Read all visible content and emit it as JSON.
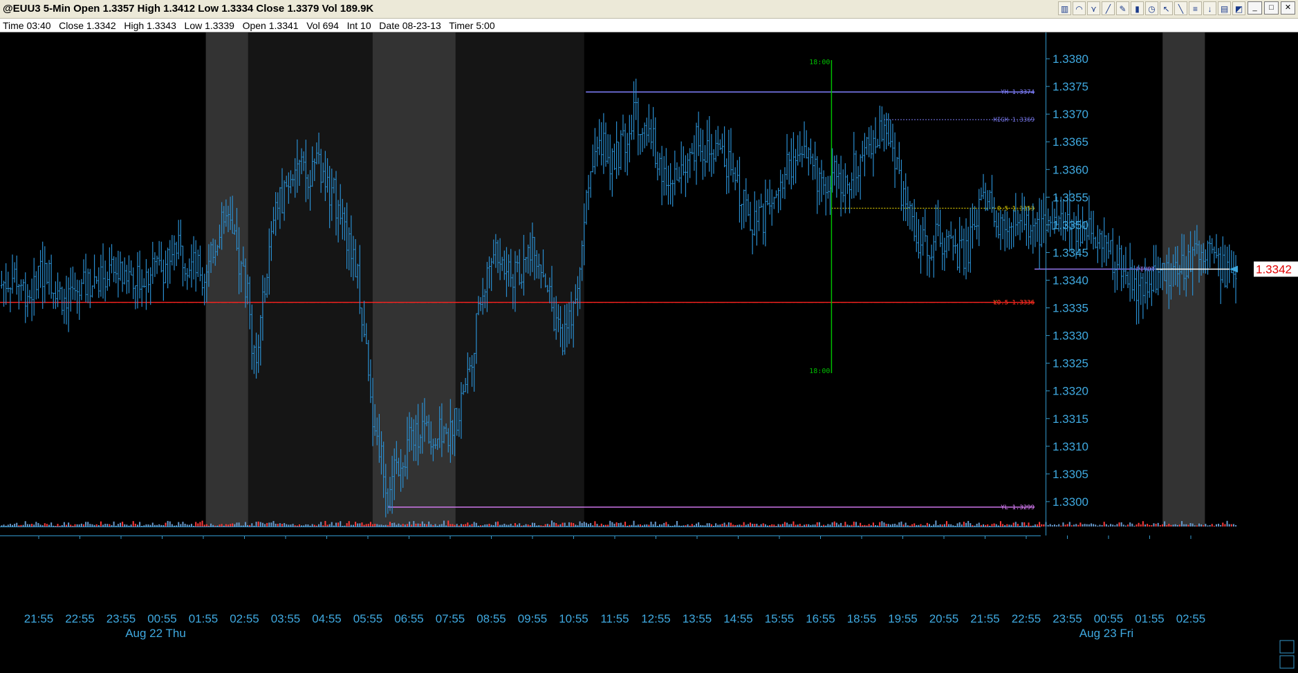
{
  "window": {
    "title": "@EUU3 5-Min Open 1.3357 High 1.3412 Low 1.3334 Close 1.3379 Vol 189.9K",
    "info": "Time 03:40   Close 1.3342   High 1.3343   Low 1.3339   Open 1.3341   Vol 694   Int 10   Date 08-23-13   Timer 5:00",
    "toolbar_icons": [
      "chart-style-icon",
      "draw-arcs-icon",
      "fib-fan-icon",
      "brush-icon",
      "pencil-icon",
      "candle-icon",
      "timer-icon",
      "cursor-icon",
      "draw-line-icon",
      "fib-retrace-icon",
      "arrow-down-icon",
      "trash-icon",
      "eraser-icon"
    ],
    "minimize": "_",
    "maximize": "□",
    "close": "✕"
  },
  "chart_data": {
    "type": "bar",
    "symbol": "@EUU3",
    "interval": "5-Min",
    "ylim": [
      1.3296,
      1.3384
    ],
    "y_ticks": [
      "1.3380",
      "1.3375",
      "1.3370",
      "1.3365",
      "1.3360",
      "1.3355",
      "1.3350",
      "1.3345",
      "1.3340",
      "1.3335",
      "1.3330",
      "1.3325",
      "1.3320",
      "1.3315",
      "1.3310",
      "1.3305",
      "1.3300"
    ],
    "x_ticks": [
      "21:55",
      "22:55",
      "23:55",
      "00:55",
      "01:55",
      "02:55",
      "03:55",
      "04:55",
      "05:55",
      "06:55",
      "07:55",
      "08:55",
      "09:55",
      "10:55",
      "11:55",
      "12:55",
      "13:55",
      "14:55",
      "15:55",
      "16:55",
      "18:55",
      "19:55",
      "20:55",
      "21:55",
      "22:55",
      "23:55",
      "00:55",
      "01:55",
      "02:55"
    ],
    "date_labels": [
      "Aug 22 Thu",
      "Aug 23 Fri"
    ],
    "last_price": "1.3342",
    "price_path": [
      [
        0,
        1.3339
      ],
      [
        18,
        1.3341
      ],
      [
        35,
        1.3337
      ],
      [
        55,
        1.3342
      ],
      [
        75,
        1.3337
      ],
      [
        95,
        1.3338
      ],
      [
        120,
        1.3341
      ],
      [
        145,
        1.3341
      ],
      [
        170,
        1.3341
      ],
      [
        195,
        1.3342
      ],
      [
        210,
        1.3346
      ],
      [
        230,
        1.3343
      ],
      [
        250,
        1.3341
      ],
      [
        262,
        1.3348
      ],
      [
        272,
        1.3351
      ],
      [
        285,
        1.3345
      ],
      [
        300,
        1.3337
      ],
      [
        305,
        1.3324
      ],
      [
        315,
        1.3333
      ],
      [
        322,
        1.3342
      ],
      [
        332,
        1.3352
      ],
      [
        345,
        1.3357
      ],
      [
        355,
        1.3362
      ],
      [
        370,
        1.3358
      ],
      [
        383,
        1.3361
      ],
      [
        392,
        1.3357
      ],
      [
        402,
        1.3356
      ],
      [
        415,
        1.3348
      ],
      [
        425,
        1.3346
      ],
      [
        432,
        1.334
      ],
      [
        440,
        1.3328
      ],
      [
        446,
        1.3318
      ],
      [
        455,
        1.3312
      ],
      [
        462,
        1.3306
      ],
      [
        468,
        1.3301
      ],
      [
        480,
        1.3307
      ],
      [
        495,
        1.3311
      ],
      [
        510,
        1.3314
      ],
      [
        525,
        1.3312
      ],
      [
        540,
        1.3312
      ],
      [
        552,
        1.3316
      ],
      [
        565,
        1.3324
      ],
      [
        576,
        1.3333
      ],
      [
        586,
        1.3341
      ],
      [
        596,
        1.3346
      ],
      [
        606,
        1.3344
      ],
      [
        618,
        1.334
      ],
      [
        630,
        1.3342
      ],
      [
        640,
        1.3346
      ],
      [
        650,
        1.3344
      ],
      [
        660,
        1.3339
      ],
      [
        670,
        1.3331
      ],
      [
        680,
        1.333
      ],
      [
        690,
        1.3335
      ],
      [
        700,
        1.3345
      ],
      [
        707,
        1.3356
      ],
      [
        716,
        1.3362
      ],
      [
        728,
        1.3364
      ],
      [
        740,
        1.3361
      ],
      [
        752,
        1.3365
      ],
      [
        764,
        1.337
      ],
      [
        780,
        1.3367
      ],
      [
        795,
        1.3362
      ],
      [
        805,
        1.3355
      ],
      [
        815,
        1.3359
      ],
      [
        825,
        1.3362
      ],
      [
        840,
        1.3365
      ],
      [
        855,
        1.3364
      ],
      [
        870,
        1.3362
      ],
      [
        885,
        1.3359
      ],
      [
        897,
        1.3353
      ],
      [
        908,
        1.335
      ],
      [
        920,
        1.3351
      ],
      [
        930,
        1.3353
      ],
      [
        942,
        1.3358
      ],
      [
        955,
        1.3362
      ],
      [
        967,
        1.3364
      ],
      [
        980,
        1.336
      ],
      [
        992,
        1.3357
      ],
      [
        1002,
        1.3359
      ],
      [
        1012,
        1.3358
      ],
      [
        1025,
        1.3359
      ],
      [
        1040,
        1.3363
      ],
      [
        1055,
        1.3366
      ],
      [
        1068,
        1.3367
      ],
      [
        1080,
        1.3362
      ],
      [
        1090,
        1.3353
      ],
      [
        1100,
        1.3351
      ],
      [
        1110,
        1.3346
      ],
      [
        1125,
        1.3347
      ],
      [
        1140,
        1.3348
      ],
      [
        1152,
        1.3345
      ],
      [
        1165,
        1.3345
      ],
      [
        1178,
        1.3353
      ],
      [
        1188,
        1.3355
      ],
      [
        1198,
        1.3351
      ],
      [
        1210,
        1.3351
      ],
      [
        1225,
        1.3352
      ],
      [
        1240,
        1.3349
      ],
      [
        1255,
        1.3349
      ],
      [
        1270,
        1.3349
      ],
      [
        1285,
        1.3351
      ],
      [
        1300,
        1.3349
      ],
      [
        1315,
        1.3348
      ],
      [
        1328,
        1.3346
      ],
      [
        1340,
        1.3344
      ],
      [
        1355,
        1.3342
      ],
      [
        1368,
        1.3339
      ],
      [
        1380,
        1.3338
      ],
      [
        1390,
        1.334
      ],
      [
        1400,
        1.3344
      ],
      [
        1410,
        1.334
      ],
      [
        1420,
        1.3341
      ],
      [
        1432,
        1.3343
      ],
      [
        1445,
        1.3346
      ],
      [
        1458,
        1.3345
      ],
      [
        1470,
        1.3343
      ],
      [
        1480,
        1.3341
      ],
      [
        1490,
        1.3342
      ]
    ],
    "session_bands": [
      [
        248,
        299
      ],
      [
        449,
        549
      ],
      [
        1401,
        1452
      ]
    ],
    "shade_bands": [
      [
        299,
        449
      ],
      [
        549,
        704
      ]
    ],
    "levels": [
      {
        "label": "YH 1.3374",
        "y": 1.3374,
        "x_start": 706,
        "color": "#8080ff",
        "style": "solid"
      },
      {
        "label": "HIGH 1.3369",
        "y": 1.3369,
        "x_start": 1065,
        "color": "#7070dd",
        "style": "dotted"
      },
      {
        "label": "0.5 1.3353",
        "y": 1.3353,
        "x_start": 1002,
        "color": "#d0c000",
        "style": "dotted"
      },
      {
        "label": "PIVOT",
        "y": 1.3342,
        "x_start": 1395,
        "color": "#a080ff",
        "style": "solid"
      },
      {
        "label": "YO.5 1.3336",
        "y": 1.3336,
        "x_start": 0,
        "color": "#c8a020",
        "style": "dashdot"
      },
      {
        "label": "LO.5 1.3336",
        "y": 1.3336,
        "x_start": 0,
        "color": "#ff2020",
        "style": "solid"
      },
      {
        "label": "YL 1.3299",
        "y": 1.3299,
        "x_start": 468,
        "color": "#e080ff",
        "style": "solid"
      }
    ],
    "time_marker": {
      "label": "18:00",
      "x": 1002,
      "color": "#00c000"
    }
  }
}
